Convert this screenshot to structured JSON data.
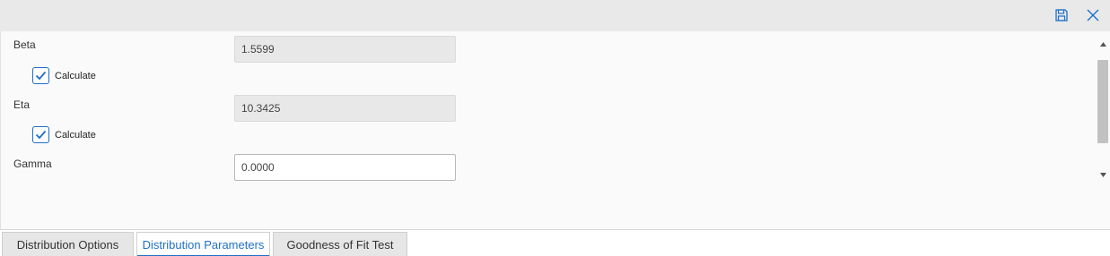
{
  "toolbar": {
    "save_icon": "save-icon",
    "close_icon": "close-icon",
    "accent_color": "#1e70c9"
  },
  "parameters": {
    "beta": {
      "label": "Beta",
      "value": "1.5599",
      "calculate_label": "Calculate",
      "calculate_checked": true
    },
    "eta": {
      "label": "Eta",
      "value": "10.3425",
      "calculate_label": "Calculate",
      "calculate_checked": true
    },
    "gamma": {
      "label": "Gamma",
      "value": "0.0000"
    }
  },
  "tabs": [
    {
      "label": "Distribution Options",
      "active": false
    },
    {
      "label": "Distribution Parameters",
      "active": true
    },
    {
      "label": "Goodness of Fit Test",
      "active": false
    }
  ]
}
